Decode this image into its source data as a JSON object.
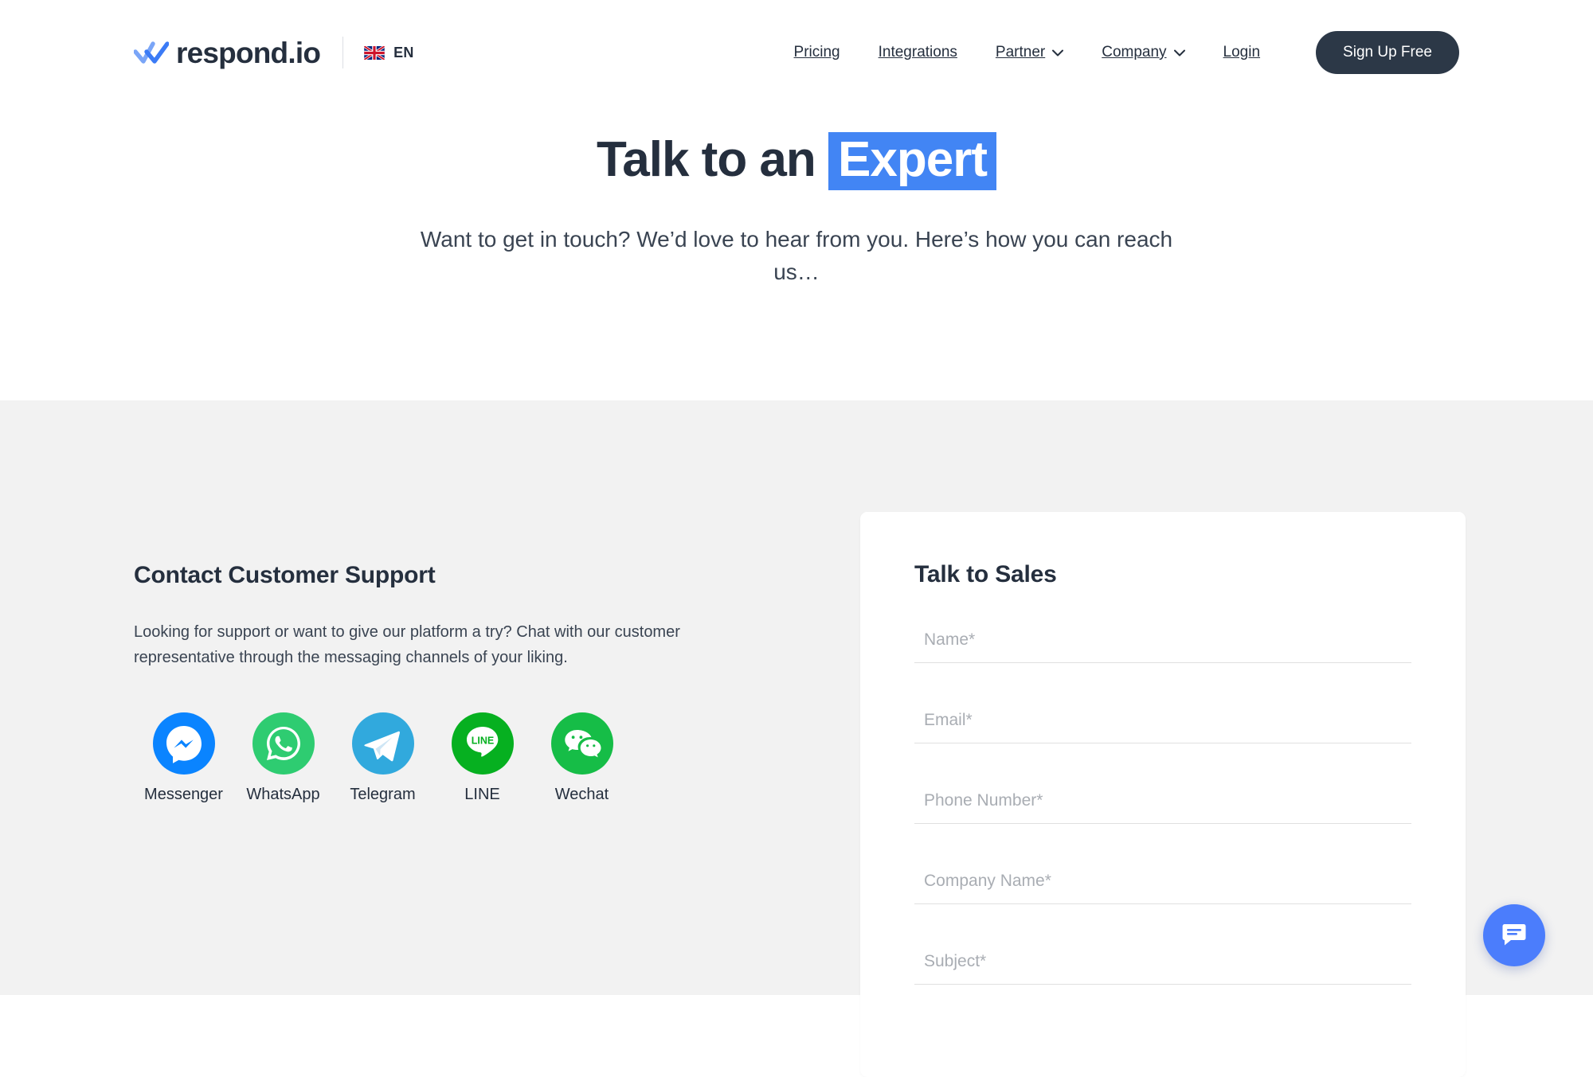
{
  "header": {
    "logo_text": "respond.io",
    "logo_icon": "double-check-icon",
    "language": {
      "code": "EN",
      "flag": "uk-flag-icon"
    },
    "nav": [
      {
        "label": "Pricing",
        "has_chevron": false
      },
      {
        "label": "Integrations",
        "has_chevron": false
      },
      {
        "label": "Partner",
        "has_chevron": true
      },
      {
        "label": "Company",
        "has_chevron": true
      },
      {
        "label": "Login",
        "has_chevron": false
      }
    ],
    "cta": {
      "label": "Sign Up Free",
      "bg": "#2c3847",
      "color": "#ffffff"
    }
  },
  "hero": {
    "title_plain": "Talk to an",
    "title_highlight": "Expert",
    "highlight_bg": "#4285f4",
    "subtitle": "Want to get in touch? We’d love to hear from you. Here’s how you can reach us…"
  },
  "support": {
    "heading": "Contact Customer Support",
    "body": "Looking for support or want to give our platform a try? Chat with our customer representative through the messaging channels of your liking.",
    "channels": [
      {
        "label": "Messenger",
        "icon": "messenger-icon",
        "color": "#0a84ff"
      },
      {
        "label": "WhatsApp",
        "icon": "whatsapp-icon",
        "color": "#2ecc71"
      },
      {
        "label": "Telegram",
        "icon": "telegram-icon",
        "color": "#31a9dd"
      },
      {
        "label": "LINE",
        "icon": "line-icon",
        "color": "#06b020"
      },
      {
        "label": "Wechat",
        "icon": "wechat-icon",
        "color": "#16bd47"
      }
    ]
  },
  "form": {
    "heading": "Talk to Sales",
    "fields": [
      {
        "name": "name",
        "placeholder": "Name*",
        "value": ""
      },
      {
        "name": "email",
        "placeholder": "Email*",
        "value": ""
      },
      {
        "name": "phone",
        "placeholder": "Phone Number*",
        "value": ""
      },
      {
        "name": "company",
        "placeholder": "Company Name*",
        "value": ""
      },
      {
        "name": "subject",
        "placeholder": "Subject*",
        "value": ""
      }
    ]
  },
  "chat_widget": {
    "icon": "chat-bubble-icon",
    "color": "#4b7dfc"
  },
  "theme": {
    "page_bg": "#ffffff",
    "section_bg": "#f2f2f2",
    "text_dark": "#252f3e",
    "accent": "#4285f4"
  }
}
